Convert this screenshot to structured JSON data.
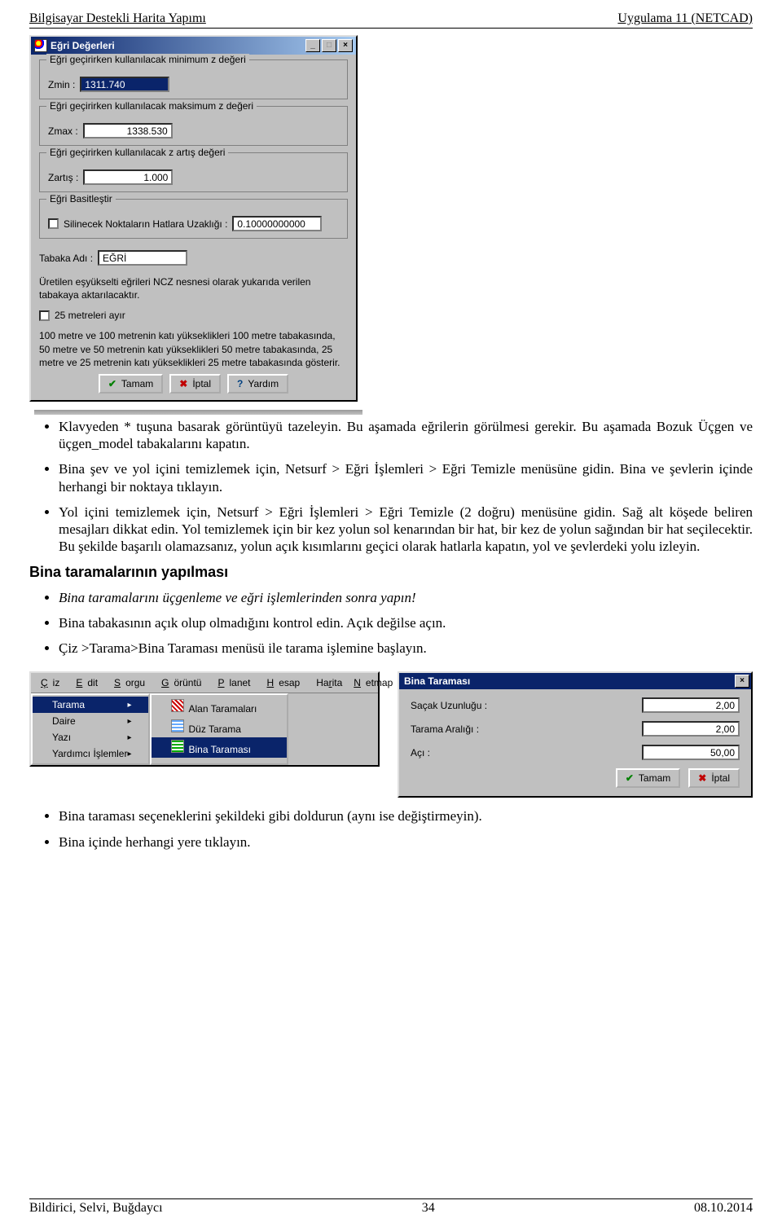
{
  "header": {
    "left": "Bilgisayar Destekli Harita Yapımı",
    "right": "Uygulama 11 (NETCAD)"
  },
  "dialog1": {
    "title": "Eğri Değerleri",
    "g1_legend": "Eğri geçirirken kullanılacak minimum z değeri",
    "g1_label": "Zmin :",
    "g1_value": "1311.740",
    "g2_legend": "Eğri geçirirken kullanılacak maksimum z değeri",
    "g2_label": "Zmax :",
    "g2_value": "1338.530",
    "g3_legend": "Eğri geçirirken kullanılacak z artış değeri",
    "g3_label": "Zartış :",
    "g3_value": "1.000",
    "g4_legend": "Eğri Basitleştir",
    "g4_chk_label": "Silinecek Noktaların Hatlara Uzaklığı :",
    "g4_value": "0.10000000000",
    "layer_label": "Tabaka Adı :",
    "layer_value": "EĞRİ",
    "note1": "Üretilen eşyükselti eğrileri  NCZ nesnesi olarak yukarıda verilen tabakaya aktarılacaktır.",
    "chk25": "25 metreleri ayır",
    "note2": "100 metre ve 100 metrenin katı yükseklikleri 100 metre tabakasında, 50 metre ve 50 metrenin katı yükseklikleri 50 metre tabakasında, 25 metre ve 25 metrenin katı yükseklikleri 25 metre tabakasında gösterir.",
    "btn_ok": "Tamam",
    "btn_cancel": "İptal",
    "btn_help": "Yardım"
  },
  "body": {
    "b1": "Klavyeden * tuşuna basarak görüntüyü tazeleyin. Bu aşamada eğrilerin görülmesi gerekir. Bu aşamada Bozuk Üçgen ve üçgen_model tabakalarını kapatın.",
    "b2": "Bina şev ve yol içini temizlemek için, Netsurf > Eğri İşlemleri > Eğri Temizle menüsüne gidin. Bina ve şevlerin içinde herhangi bir noktaya tıklayın.",
    "b3": "Yol içini temizlemek için, Netsurf > Eğri İşlemleri > Eğri Temizle (2 doğru) menüsüne gidin. Sağ alt köşede beliren mesajları dikkat edin. Yol temizlemek için bir kez yolun sol kenarından bir hat, bir kez de yolun sağından bir hat seçilecektir. Bu şekilde başarılı olamazsanız, yolun açık kısımlarını geçici olarak hatlarla kapatın, yol ve şevlerdeki yolu izleyin.",
    "sec_title": "Bina taramalarının yapılması",
    "b4": "Bina taramalarını üçgenleme ve eğri işlemlerinden sonra yapın!",
    "b5": "Bina tabakasının açık olup olmadığını kontrol edin. Açık değilse açın.",
    "b6": "Çiz >Tarama>Bina Taraması menüsü ile tarama işlemine başlayın.",
    "b7": "Bina taraması seçeneklerini şekildeki gibi doldurun (aynı ise değiştirmeyin).",
    "b8": "Bina içinde herhangi yere tıklayın."
  },
  "menubar": {
    "items": [
      {
        "pre": "Ç",
        "rest": "iz"
      },
      {
        "pre": "E",
        "rest": "dit"
      },
      {
        "pre": "S",
        "rest": "orgu"
      },
      {
        "pre": "G",
        "rest": "örüntü"
      },
      {
        "pre": "P",
        "rest": "lanet"
      },
      {
        "pre": "H",
        "rest": "esap"
      },
      {
        "pre": "Ha",
        "rest": "rita",
        "u": "r"
      },
      {
        "pre": "N",
        "rest": "etmap"
      }
    ]
  },
  "submenu": {
    "i0": "Tarama",
    "i1": "Daire",
    "i2": "Yazı",
    "i3": "Yardımcı İşlemler"
  },
  "submenu2": {
    "i0": "Alan Taramaları",
    "i1": "Düz Tarama",
    "i2": "Bina Taraması"
  },
  "dialog2": {
    "title": "Bina Taraması",
    "r1_label": "Saçak Uzunluğu :",
    "r1_value": "2,00",
    "r2_label": "Tarama Aralığı :",
    "r2_value": "2,00",
    "r3_label": "Açı :",
    "r3_value": "50,00",
    "btn_ok": "Tamam",
    "btn_cancel": "İptal"
  },
  "footer": {
    "left": "Bildirici, Selvi, Buğdaycı",
    "center": "34",
    "right": "08.10.2014"
  }
}
